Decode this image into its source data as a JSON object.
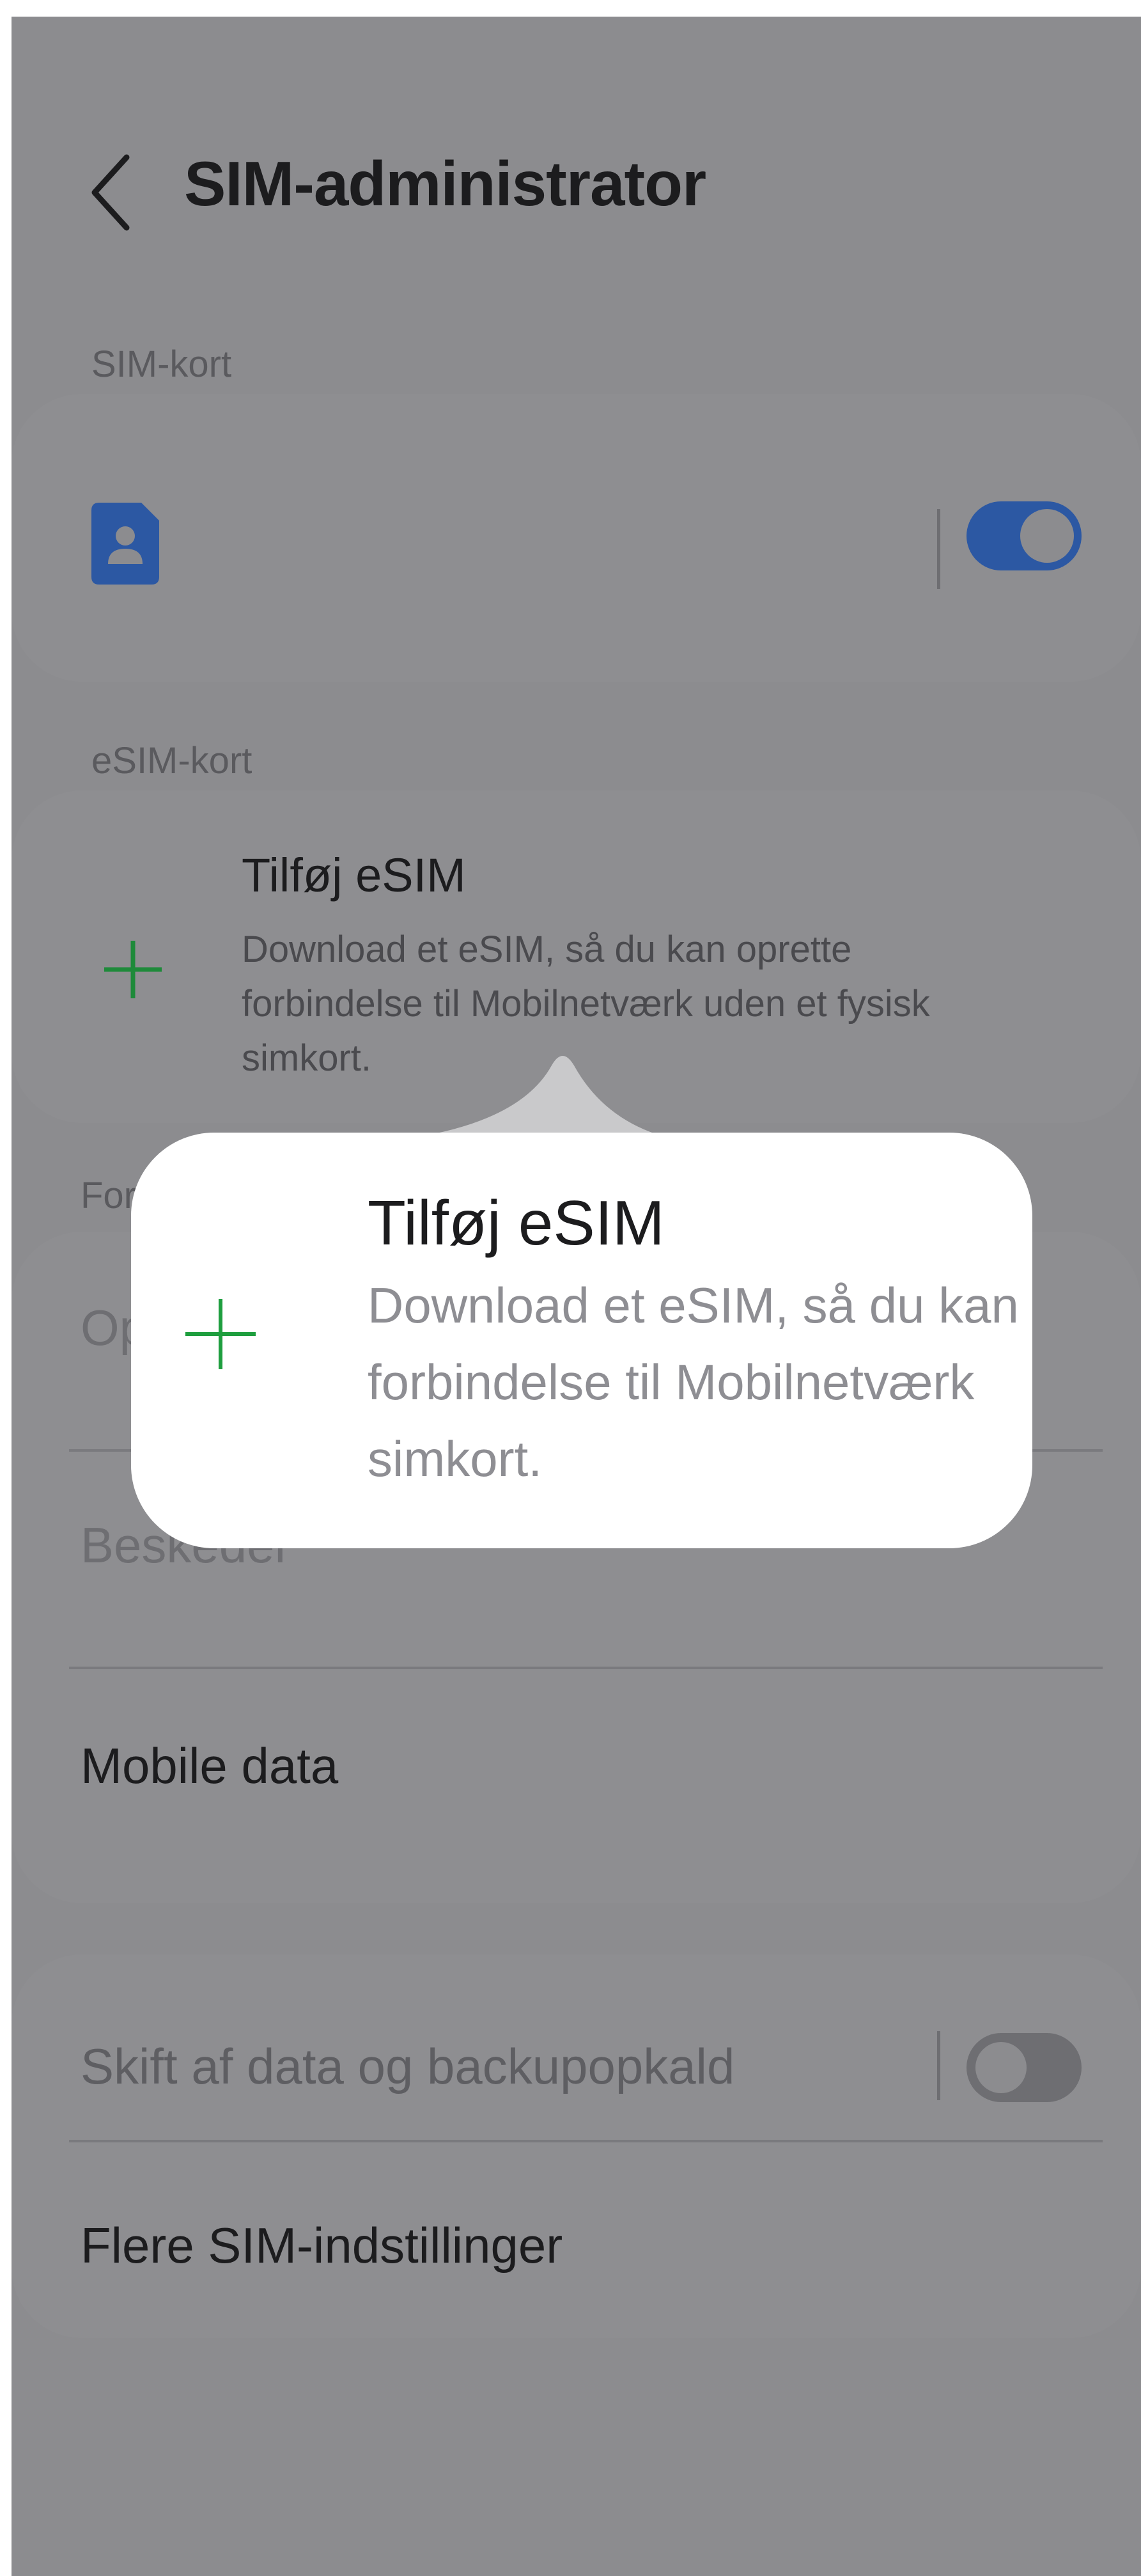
{
  "header": {
    "title": "SIM-administrator",
    "back_icon": "chevron-left-icon"
  },
  "sim_section": {
    "label": "SIM-kort",
    "sim_icon": "sim-card-person-icon",
    "toggle_on": true,
    "toggle_color": "#2c58a3"
  },
  "esim_section": {
    "label": "eSIM-kort",
    "add_title": "Tilføj eSIM",
    "add_desc_lines": [
      "Download et eSIM, så du kan oprette",
      "forbindelse til Mobilnetværk uden et fysisk",
      "simkort."
    ],
    "plus_icon": "plus-icon",
    "plus_color": "#1e9e3e"
  },
  "preferred_section": {
    "label_visible": "For",
    "calls_visible": "Op",
    "messages_visible": "Beskeder",
    "mobile_data": "Mobile data"
  },
  "backup_section": {
    "switch_label": "Skift af data og backupopkald",
    "toggle_on": false,
    "more_settings": "Flere SIM-indstillinger"
  },
  "zoom_popup": {
    "title": "Tilføj eSIM",
    "desc_lines": [
      "Download et eSIM, så du kan",
      "forbindelse til Mobilnetværk",
      "simkort."
    ]
  }
}
